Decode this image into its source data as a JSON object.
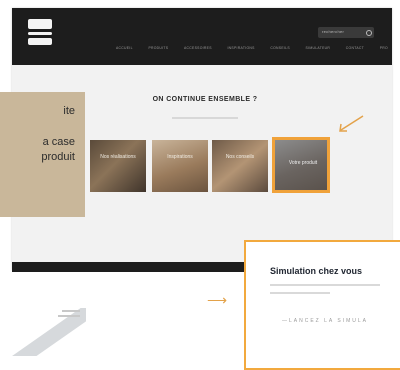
{
  "header": {
    "search_placeholder": "rechercher",
    "menu": [
      "ACCUEIL",
      "PRODUITS",
      "ACCESSOIRES",
      "INSPIRATIONS",
      "CONSEILS",
      "SIMULATEUR",
      "CONTACT",
      "PRO"
    ]
  },
  "section": {
    "title": "ON CONTINUE ENSEMBLE ?"
  },
  "tiles": [
    {
      "label": "Nos réalisations"
    },
    {
      "label": "Inspirations"
    },
    {
      "label": "Nos conseils"
    },
    {
      "label": "Votre produit"
    }
  ],
  "annotation": {
    "line1": "ite",
    "line2": "a case",
    "line3": "produit"
  },
  "simulation": {
    "title": "Simulation chez vous",
    "cta": "—LANCEZ LA SIMULA"
  },
  "colors": {
    "accent": "#f2a93e",
    "nav_bg": "#1d1d1d",
    "annotation_bg": "#c9b79a"
  }
}
